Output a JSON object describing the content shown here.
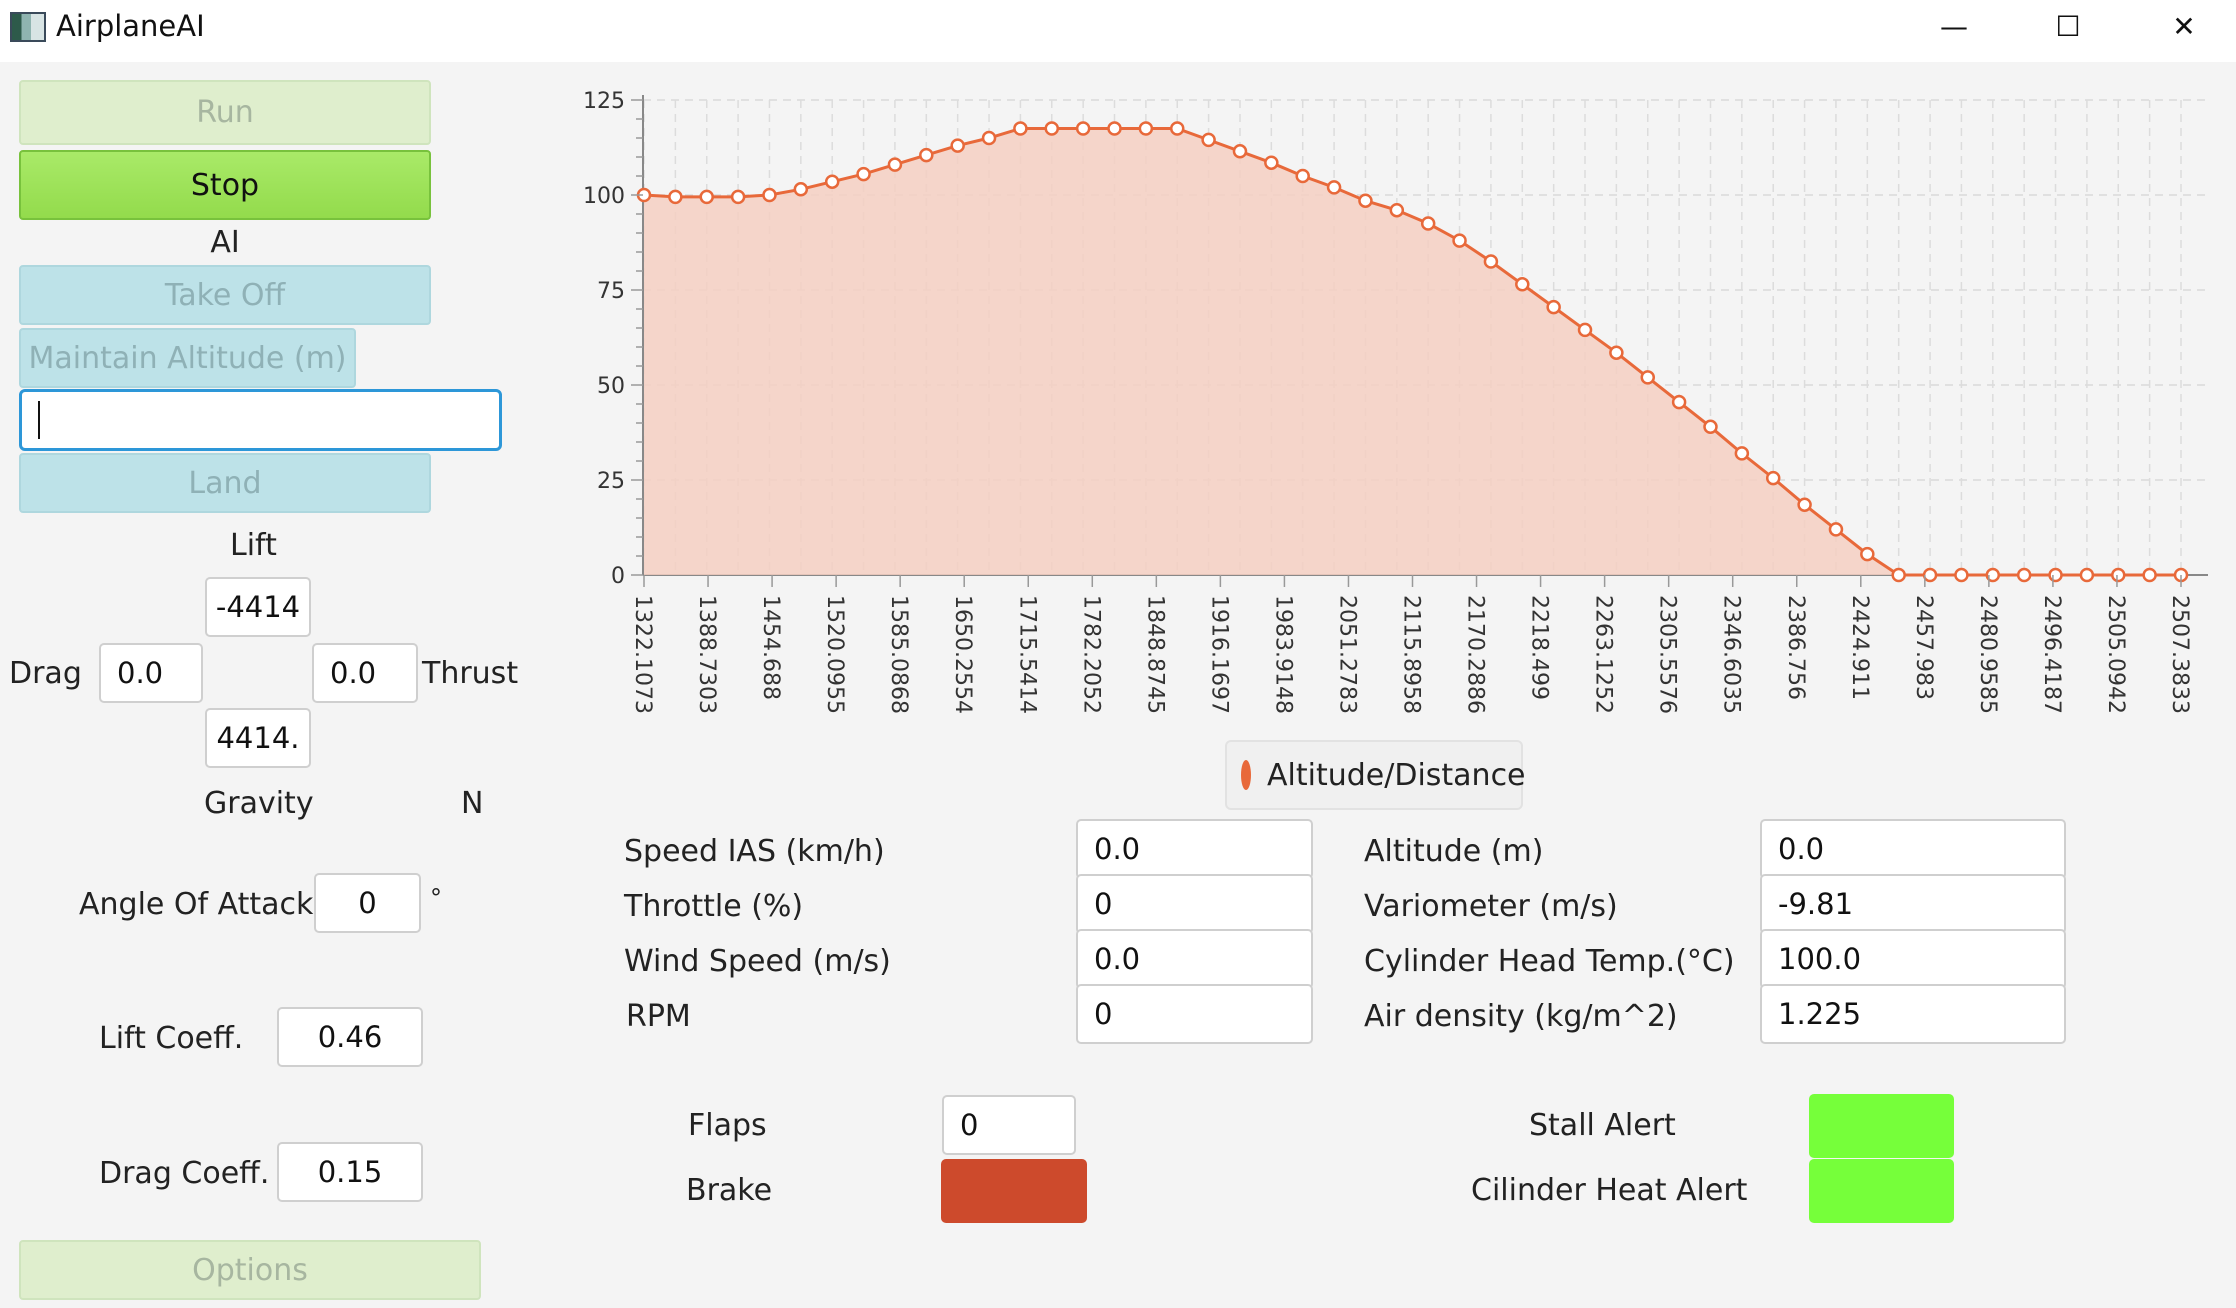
{
  "window": {
    "title": "AirplaneAI",
    "controls": {
      "minimize": "—",
      "maximize": "☐",
      "close": "✕"
    }
  },
  "sidebar": {
    "run_label": "Run",
    "stop_label": "Stop",
    "ai_heading": "AI",
    "takeoff_label": "Take Off",
    "maintain_altitude_label": "Maintain Altitude (m)",
    "altitude_input_value": "",
    "land_label": "Land",
    "options_label": "Options"
  },
  "forces": {
    "lift_label": "Lift",
    "lift_value": "-4414",
    "drag_label": "Drag",
    "drag_value": "0.0",
    "thrust_label": "Thrust",
    "thrust_value": "0.0",
    "gravity_value": "4414.",
    "gravity_label": "Gravity",
    "unit_label": "N"
  },
  "aero": {
    "aoa_label": "Angle Of Attack",
    "aoa_value": "0",
    "aoa_unit": "°",
    "lift_coeff_label": "Lift Coeff.",
    "lift_coeff_value": "0.46",
    "drag_coeff_label": "Drag Coeff.",
    "drag_coeff_value": "0.15"
  },
  "chart_data": {
    "type": "area",
    "series": [
      {
        "name": "Altitude/Distance",
        "values": [
          100,
          99.5,
          99.5,
          99.5,
          100,
          101.5,
          103.5,
          105.5,
          108,
          110.5,
          113,
          115,
          117.5,
          117.5,
          117.5,
          117.5,
          117.5,
          117.5,
          114.5,
          111.5,
          108.5,
          105,
          102,
          98.5,
          96,
          92.5,
          88,
          82.5,
          76.5,
          70.5,
          64.5,
          58.5,
          52,
          45.5,
          39,
          32,
          25.5,
          18.5,
          12,
          5.5,
          0,
          0,
          0,
          0,
          0,
          0,
          0,
          0,
          0,
          0
        ]
      }
    ],
    "x_tick_labels": [
      "1322.1073",
      "1388.7303",
      "1454.688",
      "1520.0955",
      "1585.0868",
      "1650.2554",
      "1715.5414",
      "1782.2052",
      "1848.8745",
      "1916.1697",
      "1983.9148",
      "2051.2783",
      "2115.8958",
      "2170.2886",
      "2218.499",
      "2263.1252",
      "2305.5576",
      "2346.6035",
      "2386.756",
      "2424.911",
      "2457.983",
      "2480.9585",
      "2496.4187",
      "2505.0942",
      "2507.3833"
    ],
    "y_ticks": [
      0,
      25,
      50,
      75,
      100,
      125
    ],
    "ylim": [
      0,
      125
    ],
    "grid": true,
    "colors": {
      "line": "#e8693a",
      "fill": "#f5cfc2"
    },
    "legend_label": "Altitude/Distance",
    "legend_position": "bottom"
  },
  "instruments": {
    "speed_label": "Speed IAS (km/h)",
    "speed_value": "0.0",
    "throttle_label": "Throttle (%)",
    "throttle_value": "0",
    "wind_label": "Wind Speed (m/s)",
    "wind_value": "0.0",
    "rpm_label": "RPM",
    "rpm_value": "0",
    "altitude_label": "Altitude (m)",
    "altitude_value": "0.0",
    "vario_label": "Variometer (m/s)",
    "vario_value": "-9.81",
    "cht_label": "Cylinder Head Temp.(°C)",
    "cht_value": "100.0",
    "air_density_label": "Air density (kg/m^2)",
    "air_density_value": "1.225"
  },
  "controls": {
    "flaps_label": "Flaps",
    "flaps_value": "0",
    "brake_label": "Brake",
    "brake_color": "#cd4a2c"
  },
  "alerts": {
    "stall_label": "Stall Alert",
    "stall_color": "#76ff3a",
    "heat_label": "Cilinder Heat Alert",
    "heat_color": "#76ff3a"
  }
}
